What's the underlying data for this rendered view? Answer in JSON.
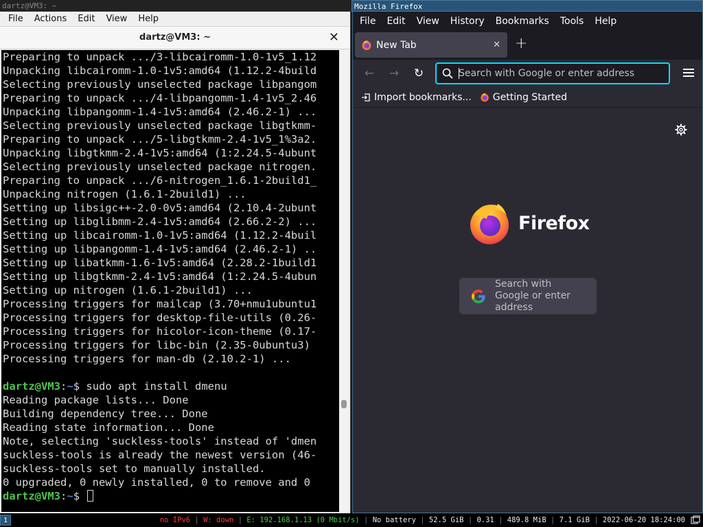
{
  "left_frame": {
    "title": "dartz@VM3: ~"
  },
  "terminal": {
    "menu": [
      "File",
      "Actions",
      "Edit",
      "View",
      "Help"
    ],
    "title": "dartz@VM3: ~",
    "close_glyph": "✕",
    "lines": [
      "Preparing to unpack .../3-libcairomm-1.0-1v5_1.12",
      "Unpacking libcairomm-1.0-1v5:amd64 (1.12.2-4build",
      "Selecting previously unselected package libpangom",
      "Preparing to unpack .../4-libpangomm-1.4-1v5_2.46",
      "Unpacking libpangomm-1.4-1v5:amd64 (2.46.2-1) ...",
      "Selecting previously unselected package libgtkmm-",
      "Preparing to unpack .../5-libgtkmm-2.4-1v5_1%3a2.",
      "Unpacking libgtkmm-2.4-1v5:amd64 (1:2.24.5-4ubunt",
      "Selecting previously unselected package nitrogen.",
      "Preparing to unpack .../6-nitrogen_1.6.1-2build1_",
      "Unpacking nitrogen (1.6.1-2build1) ...",
      "Setting up libsigc++-2.0-0v5:amd64 (2.10.4-2ubunt",
      "Setting up libglibmm-2.4-1v5:amd64 (2.66.2-2) ...",
      "Setting up libcairomm-1.0-1v5:amd64 (1.12.2-4buil",
      "Setting up libpangomm-1.4-1v5:amd64 (2.46.2-1) ..",
      "Setting up libatkmm-1.6-1v5:amd64 (2.28.2-1build1",
      "Setting up libgtkmm-2.4-1v5:amd64 (1:2.24.5-4ubun",
      "Setting up nitrogen (1.6.1-2build1) ...",
      "Processing triggers for mailcap (3.70+nmu1ubuntu1",
      "Processing triggers for desktop-file-utils (0.26-",
      "Processing triggers for hicolor-icon-theme (0.17-",
      "Processing triggers for libc-bin (2.35-0ubuntu3)",
      "Processing triggers for man-db (2.10.2-1) ...",
      ""
    ],
    "prompt_user": "dartz@VM3",
    "prompt_sep": ":",
    "prompt_path": "~",
    "prompt_symbol": "$ ",
    "command": "sudo apt install dmenu",
    "output_lines": [
      "Reading package lists... Done",
      "Building dependency tree... Done",
      "Reading state information... Done",
      "Note, selecting 'suckless-tools' instead of 'dmen",
      "suckless-tools is already the newest version (46-",
      "suckless-tools set to manually installed.",
      "0 upgraded, 0 newly installed, 0 to remove and 0"
    ]
  },
  "right_frame": {
    "title": "Mozilla Firefox"
  },
  "firefox": {
    "menu": [
      "File",
      "Edit",
      "View",
      "History",
      "Bookmarks",
      "Tools",
      "Help"
    ],
    "tab": {
      "label": "New Tab",
      "close_glyph": "✕"
    },
    "new_tab_glyph": "+",
    "nav": {
      "back": "←",
      "forward": "→",
      "reload": "↻"
    },
    "url_placeholder": "Search with Google or enter address",
    "bookmarks": [
      "Import bookmarks...",
      "Getting Started"
    ],
    "brand": "Firefox",
    "content_search_text": "Search with Google or enter address"
  },
  "statusbar": {
    "workspace": "1",
    "ipv6": "no IPv6",
    "wifi": "W: down",
    "ethernet": "E: 192.168.1.13 (0 Mbit/s)",
    "battery": "No battery",
    "disk": "52.5 GiB",
    "load": "0.31",
    "memory": "489.8 MiB",
    "mem_avail": "7.1 GiB",
    "datetime": "2022-06-20 18:24:00",
    "separator": "|"
  },
  "colors": {
    "focused_border": "#4c7899",
    "focused_title_bg": "#285577",
    "firefox_bg": "#2b2a33",
    "urlbar_focus": "#00ddff",
    "prompt_green": "#4ec54e",
    "prompt_blue": "#4f7fd8",
    "status_red": "#ff3b3b",
    "status_green": "#46d146"
  }
}
